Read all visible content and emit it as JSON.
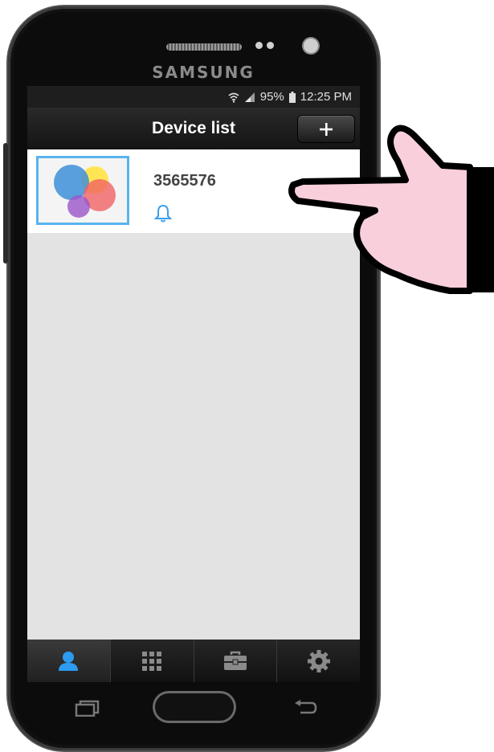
{
  "device": {
    "brand": "SAMSUNG"
  },
  "status_bar": {
    "battery": "95%",
    "time": "12:25 PM",
    "icons": [
      "wifi-icon",
      "signal-icon",
      "battery-icon"
    ]
  },
  "header": {
    "title": "Device list",
    "add_button_icon": "plus-icon"
  },
  "devices": [
    {
      "name": "3565576",
      "icon": "bell-icon",
      "thumbnail": "colorful-circles-logo"
    }
  ],
  "tab_bar": {
    "tabs": [
      {
        "icon": "person-icon",
        "active": true
      },
      {
        "icon": "grid-icon",
        "active": false
      },
      {
        "icon": "toolbox-icon",
        "active": false
      },
      {
        "icon": "gear-icon",
        "active": false
      }
    ]
  },
  "colors": {
    "accent": "#3aa0f0",
    "thumb_border": "#58b3ee",
    "hand_fill": "#f9cfdc"
  }
}
